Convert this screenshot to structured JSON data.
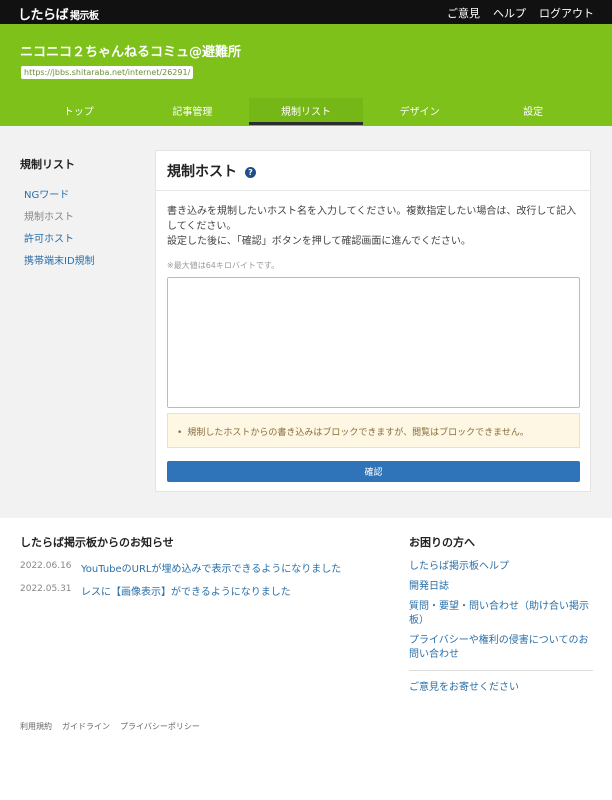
{
  "header": {
    "logo": "したらば",
    "logo_sub": "掲示板",
    "nav": [
      "ご意見",
      "ヘルプ",
      "ログアウト"
    ]
  },
  "board": {
    "title": "ニコニコ２ちゃんねるコミュ@避難所",
    "url": "https://jbbs.shitaraba.net/internet/26291/"
  },
  "tabs": [
    {
      "label": "トップ",
      "active": false
    },
    {
      "label": "記事管理",
      "active": false
    },
    {
      "label": "規制リスト",
      "active": true
    },
    {
      "label": "デザイン",
      "active": false
    },
    {
      "label": "設定",
      "active": false
    }
  ],
  "sidebar": {
    "title": "規制リスト",
    "items": [
      {
        "label": "NGワード",
        "current": false
      },
      {
        "label": "規制ホスト",
        "current": true
      },
      {
        "label": "許可ホスト",
        "current": false
      },
      {
        "label": "携帯端末ID規制",
        "current": false
      }
    ]
  },
  "panel": {
    "title": "規制ホスト",
    "help_icon": "?",
    "desc_line1": "書き込みを規制したいホスト名を入力してください。複数指定したい場合は、改行して記入してください。",
    "desc_line2": "設定した後に、「確認」ボタンを押して確認画面に進んでください。",
    "note": "※最大値は64キロバイトです。",
    "textarea_value": "",
    "alert": "規制したホストからの書き込みはブロックできますが、閲覧はブロックできません。",
    "confirm_label": "確認"
  },
  "news": {
    "title": "したらば掲示板からのお知らせ",
    "items": [
      {
        "date": "2022.06.16",
        "text": "YouTubeのURLが埋め込みで表示できるようになりました"
      },
      {
        "date": "2022.05.31",
        "text": "レスに【画像表示】ができるようになりました"
      }
    ]
  },
  "help": {
    "title": "お困りの方へ",
    "links": [
      "したらば掲示板ヘルプ",
      "開発日誌",
      "質問・要望・問い合わせ（助け合い掲示板）",
      "プライバシーや権利の侵害についてのお問い合わせ"
    ],
    "feedback": "ご意見をお寄せください"
  },
  "legal": [
    "利用規約",
    "ガイドライン",
    "プライバシーポリシー"
  ],
  "colors": {
    "brand_green": "#7dc11a",
    "topbar": "#111111",
    "link": "#2a6fa8",
    "button": "#2f73b8",
    "alert_bg": "#fdf7e3"
  }
}
